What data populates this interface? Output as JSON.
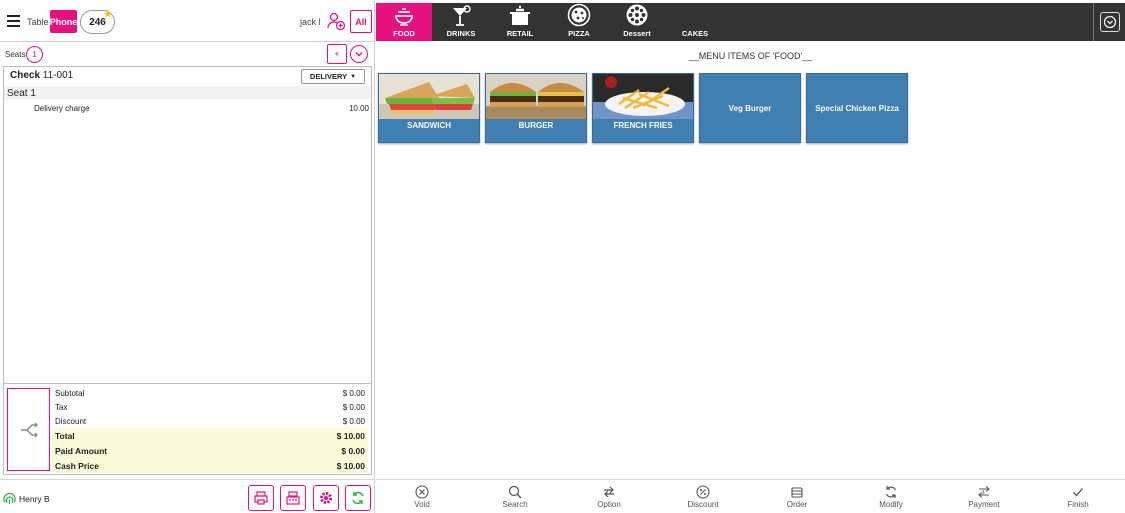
{
  "header": {
    "table_label": "Table",
    "phone_label": "Phone",
    "order_number": "246",
    "user": "jack l",
    "all_label": "All"
  },
  "seats": {
    "label": "Seats",
    "count": "1",
    "add_label": "+"
  },
  "check": {
    "label": "Check",
    "number": "11-001",
    "order_type": "DELIVERY",
    "seat_label": "Seat 1",
    "items": [
      {
        "name": "Delivery charge",
        "price": "10.00"
      }
    ]
  },
  "totals": {
    "subtotal_label": "Subtotal",
    "subtotal": "$ 0.00",
    "tax_label": "Tax",
    "tax": "$ 0.00",
    "discount_label": "Discount",
    "discount": "$ 0.00",
    "total_label": "Total",
    "total": "$ 10.00",
    "paid_label": "Paid Amount",
    "paid": "$ 0.00",
    "cash_label": "Cash Price",
    "cash": "$ 10.00"
  },
  "footer": {
    "cashier": "Henry B"
  },
  "categories": [
    {
      "label": "FOOD",
      "icon": "food-bowl-icon",
      "active": true
    },
    {
      "label": "DRINKS",
      "icon": "cocktail-icon",
      "active": false
    },
    {
      "label": "RETAIL",
      "icon": "pot-icon",
      "active": false
    },
    {
      "label": "PIZZA",
      "icon": "pizza-icon",
      "active": false
    },
    {
      "label": "Dessert",
      "icon": "dessert-icon",
      "active": false
    },
    {
      "label": "CAKES",
      "icon": "",
      "active": false
    }
  ],
  "menu": {
    "title": "__MENU ITEMS OF 'FOOD'__",
    "items": [
      {
        "label": "SANDWICH"
      },
      {
        "label": "BURGER"
      },
      {
        "label": "FRENCH FRIES"
      },
      {
        "label": "Veg Burger"
      },
      {
        "label": "Special Chicken Pizza"
      }
    ]
  },
  "actions": [
    {
      "label": "Void",
      "icon": "void-icon"
    },
    {
      "label": "Search",
      "icon": "search-icon"
    },
    {
      "label": "Option",
      "icon": "option-icon"
    },
    {
      "label": "Discount",
      "icon": "discount-icon"
    },
    {
      "label": "Order",
      "icon": "order-icon"
    },
    {
      "label": "Modify",
      "icon": "modify-icon"
    },
    {
      "label": "Payment",
      "icon": "payment-icon"
    },
    {
      "label": "Finish",
      "icon": "check-icon"
    }
  ],
  "colors": {
    "accent": "#e6117f",
    "category_bar": "#333333",
    "tile": "#3f7fb1",
    "highlight_row": "#fbfbd9"
  }
}
